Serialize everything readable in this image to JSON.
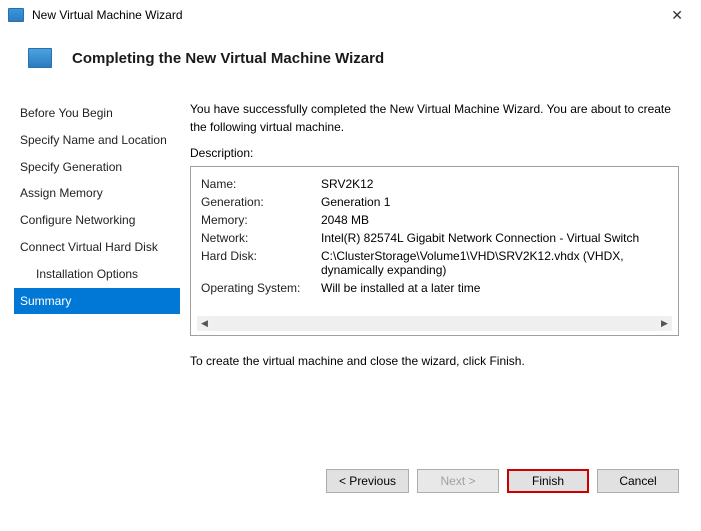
{
  "titlebar": {
    "title": "New Virtual Machine Wizard"
  },
  "header": {
    "title": "Completing the New Virtual Machine Wizard"
  },
  "sidebar": {
    "items": [
      {
        "label": "Before You Begin"
      },
      {
        "label": "Specify Name and Location"
      },
      {
        "label": "Specify Generation"
      },
      {
        "label": "Assign Memory"
      },
      {
        "label": "Configure Networking"
      },
      {
        "label": "Connect Virtual Hard Disk"
      },
      {
        "label": "Installation Options"
      },
      {
        "label": "Summary"
      }
    ]
  },
  "main": {
    "intro": "You have successfully completed the New Virtual Machine Wizard. You are about to create the following virtual machine.",
    "description_label": "Description:",
    "rows": [
      {
        "k": "Name:",
        "v": "SRV2K12"
      },
      {
        "k": "Generation:",
        "v": "Generation 1"
      },
      {
        "k": "Memory:",
        "v": "2048 MB"
      },
      {
        "k": "Network:",
        "v": "Intel(R) 82574L Gigabit Network Connection - Virtual Switch"
      },
      {
        "k": "Hard Disk:",
        "v": "C:\\ClusterStorage\\Volume1\\VHD\\SRV2K12.vhdx (VHDX, dynamically expanding)"
      },
      {
        "k": "Operating System:",
        "v": "Will be installed at a later time"
      }
    ],
    "closing": "To create the virtual machine and close the wizard, click Finish."
  },
  "footer": {
    "previous": "< Previous",
    "next": "Next >",
    "finish": "Finish",
    "cancel": "Cancel"
  }
}
